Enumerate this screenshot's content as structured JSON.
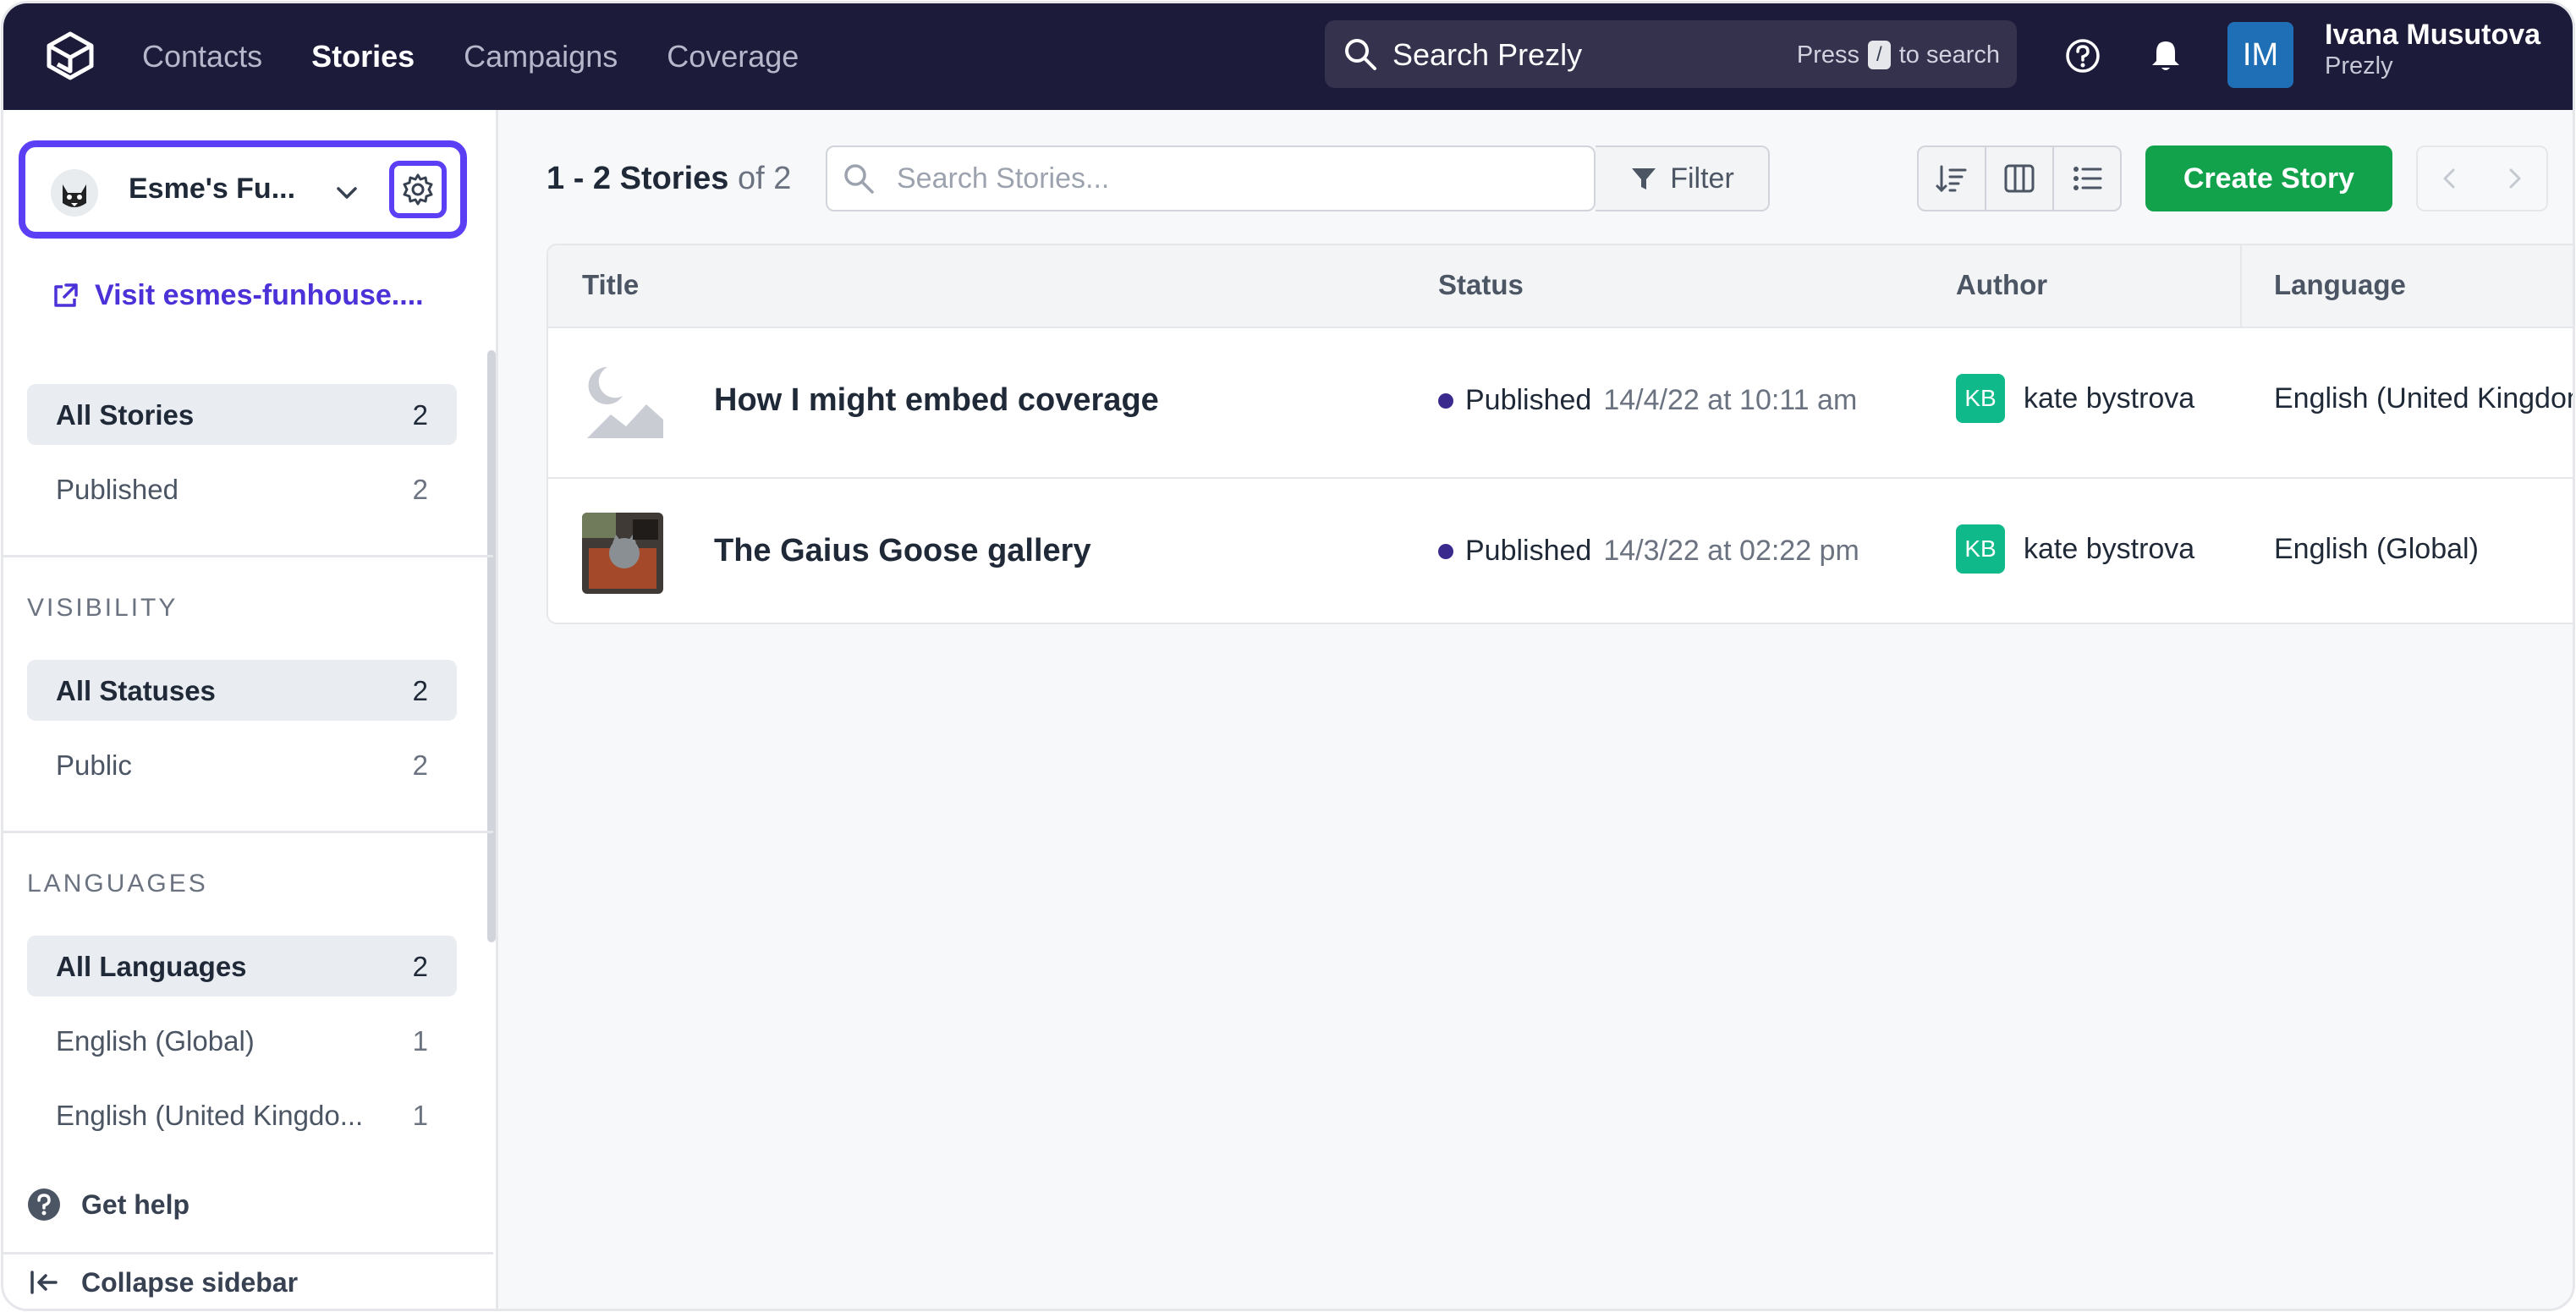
{
  "topbar": {
    "nav": [
      "Contacts",
      "Stories",
      "Campaigns",
      "Coverage"
    ],
    "active_nav": "Stories",
    "search_placeholder": "Search Prezly",
    "search_hint_press": "Press",
    "search_hint_key": "/",
    "search_hint_suffix": "to search",
    "user_initials": "IM",
    "user_name": "Ivana Musutova",
    "user_org": "Prezly"
  },
  "sidebar": {
    "newsroom_name": "Esme's Fu...",
    "visit_link": "Visit esmes-funhouse....",
    "stories": [
      {
        "label": "All Stories",
        "count": "2",
        "active": true
      },
      {
        "label": "Published",
        "count": "2",
        "active": false
      }
    ],
    "visibility_heading": "VISIBILITY",
    "visibility": [
      {
        "label": "All Statuses",
        "count": "2",
        "active": true
      },
      {
        "label": "Public",
        "count": "2",
        "active": false
      }
    ],
    "languages_heading": "LANGUAGES",
    "languages": [
      {
        "label": "All Languages",
        "count": "2",
        "active": true
      },
      {
        "label": "English (Global)",
        "count": "1",
        "active": false
      },
      {
        "label": "English (United Kingdo...",
        "count": "1",
        "active": false
      }
    ],
    "get_help": "Get help",
    "collapse": "Collapse sidebar"
  },
  "toolbar": {
    "count_range": "1 - 2 Stories",
    "count_total": "of 2",
    "search_placeholder": "Search Stories...",
    "filter_label": "Filter",
    "create_label": "Create Story"
  },
  "table": {
    "columns": [
      "Title",
      "Status",
      "Author",
      "Language"
    ],
    "rows": [
      {
        "title": "How I might embed coverage",
        "status": "Published",
        "date": "14/4/22 at 10:11 am",
        "author_initials": "KB",
        "author": "kate bystrova",
        "language": "English (United Kingdom)"
      },
      {
        "title": "The Gaius Goose gallery",
        "status": "Published",
        "date": "14/3/22 at 02:22 pm",
        "author_initials": "KB",
        "author": "kate bystrova",
        "language": "English (Global)"
      }
    ]
  },
  "colors": {
    "topbar": "#1d1b3a",
    "accent": "#5b3ff5",
    "create_button": "#11a24b",
    "author_badge": "#10b98a",
    "status_dot": "#3b2a8e"
  }
}
